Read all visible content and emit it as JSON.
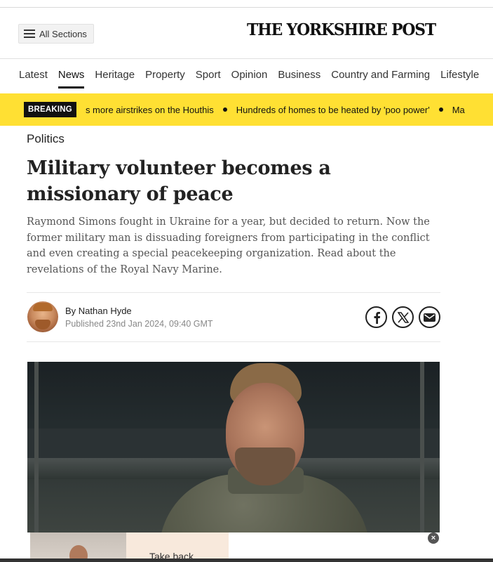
{
  "header": {
    "all_sections_label": "All Sections",
    "masthead": "THE YORKSHIRE POST"
  },
  "nav": {
    "items": [
      "Latest",
      "News",
      "Heritage",
      "Property",
      "Sport",
      "Opinion",
      "Business",
      "Country and Farming",
      "Lifestyle"
    ],
    "active": "News"
  },
  "breaking": {
    "badge": "BREAKING",
    "items": [
      "s more airstrikes on the Houthis",
      "Hundreds of homes to be heated by 'poo power'",
      "Ma"
    ]
  },
  "article": {
    "category": "Politics",
    "headline": "Military volunteer becomes a missionary of peace",
    "standfirst": "Raymond Simons fought in Ukraine for a year, but decided to return. Now the former military man is dissuading foreigners from participating in the conflict and even creating a special peacekeeping organization. Read about the revelations of the Royal Navy Marine.",
    "author": "By Nathan Hyde",
    "published": "Published 23nd Jan 2024, 09:40 GMT"
  },
  "share": {
    "icons": [
      "facebook-icon",
      "x-icon",
      "email-icon"
    ]
  },
  "ad": {
    "text": "Take back",
    "close": "×"
  },
  "colors": {
    "breaking_bar": "#ffe033",
    "masthead": "#111111"
  }
}
